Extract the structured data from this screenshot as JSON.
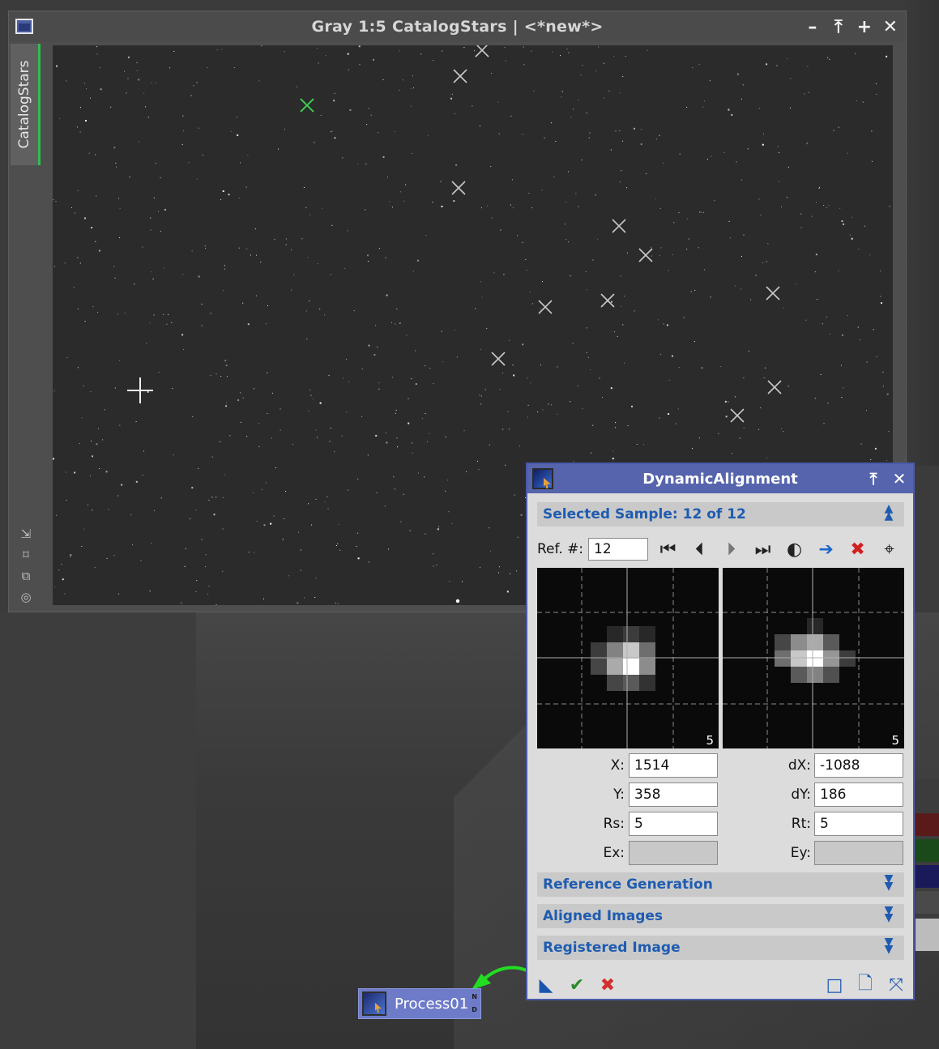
{
  "image_window": {
    "title": "Gray 1:5 CatalogStars | <*new*>",
    "side_tab": "CatalogStars",
    "controls": [
      "–",
      "⤒",
      "+",
      "✕"
    ]
  },
  "dialog": {
    "title": "DynamicAlignment",
    "controls": [
      "⤒",
      "✕"
    ],
    "selected_sample": "Selected Sample: 12 of 12",
    "ref_label": "Ref. #:",
    "ref_value": "12",
    "preview_left_number": "5",
    "preview_right_number": "5",
    "x_label": "X:",
    "x_value": "1514",
    "y_label": "Y:",
    "y_value": "358",
    "rs_label": "Rs:",
    "rs_value": "5",
    "ex_label": "Ex:",
    "ex_value": "",
    "dx_label": "dX:",
    "dx_value": "-1088",
    "dy_label": "dY:",
    "dy_value": "186",
    "rt_label": "Rt:",
    "rt_value": "5",
    "ey_label": "Ey:",
    "ey_value": "",
    "sections": [
      "Reference Generation",
      "Aligned Images",
      "Registered Image"
    ]
  },
  "process_icon": {
    "label": "Process01",
    "n": "N",
    "d": "D"
  },
  "colors": {
    "accent": "#5564ad",
    "section_text": "#1f5cb0",
    "green": "#2fbf4f",
    "red": "#d02020"
  }
}
